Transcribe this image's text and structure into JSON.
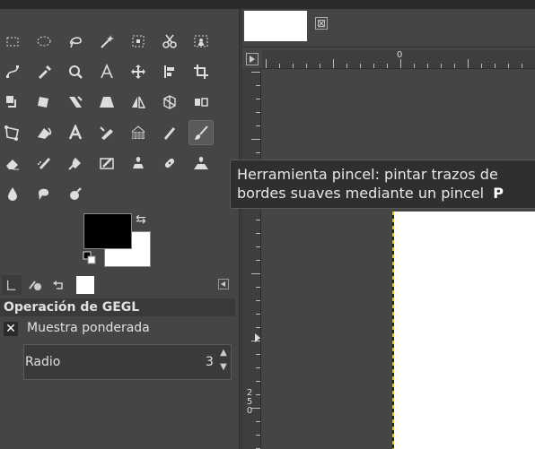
{
  "toolbox": {
    "tools": [
      {
        "name": "rect-select-icon"
      },
      {
        "name": "ellipse-select-icon"
      },
      {
        "name": "lasso-select-icon"
      },
      {
        "name": "fuzzy-select-icon"
      },
      {
        "name": "select-by-color-icon"
      },
      {
        "name": "scissors-select-icon"
      },
      {
        "name": "foreground-select-icon"
      },
      {
        "name": "paths-icon"
      },
      {
        "name": "color-picker-icon"
      },
      {
        "name": "zoom-icon"
      },
      {
        "name": "measure-icon"
      },
      {
        "name": "move-icon"
      },
      {
        "name": "align-icon"
      },
      {
        "name": "crop-icon"
      },
      {
        "name": "unified-transform-icon"
      },
      {
        "name": "rotate-icon"
      },
      {
        "name": "shear-icon"
      },
      {
        "name": "perspective-icon"
      },
      {
        "name": "flip-icon"
      },
      {
        "name": "cage-transform-icon"
      },
      {
        "name": "warp-transform-icon"
      },
      {
        "name": "handle-transform-icon"
      },
      {
        "name": "bucket-fill-icon"
      },
      {
        "name": "text-icon"
      },
      {
        "name": "gradient-icon"
      },
      {
        "name": "pattern-icon"
      },
      {
        "name": "pencil-icon"
      },
      {
        "name": "paintbrush-icon"
      },
      {
        "name": "eraser-icon"
      },
      {
        "name": "airbrush-icon"
      },
      {
        "name": "ink-icon"
      },
      {
        "name": "mypaint-brush-icon"
      },
      {
        "name": "clone-icon"
      },
      {
        "name": "heal-icon"
      },
      {
        "name": "perspective-clone-icon"
      },
      {
        "name": "blur-icon"
      },
      {
        "name": "smudge-icon"
      },
      {
        "name": "dodge-burn-icon"
      }
    ],
    "active_tool": "paintbrush-icon",
    "colors": {
      "foreground": "#000000",
      "background": "#ffffff"
    }
  },
  "tooltip": {
    "line1": "Herramienta pincel: pintar trazos de",
    "line2": "bordes suaves mediante un pincel",
    "shortcut": "P"
  },
  "tool_options": {
    "header": "Operación de GEGL",
    "checkbox_label": "Muestra ponderada",
    "checkbox_checked": true,
    "checkbox_mark": "✕",
    "radius_label": "Radio",
    "radius_value": "3"
  },
  "rulers": {
    "horizontal_zero": "0",
    "vertical_mark": "250"
  },
  "image_tab": {
    "close_glyph": "⊠"
  }
}
